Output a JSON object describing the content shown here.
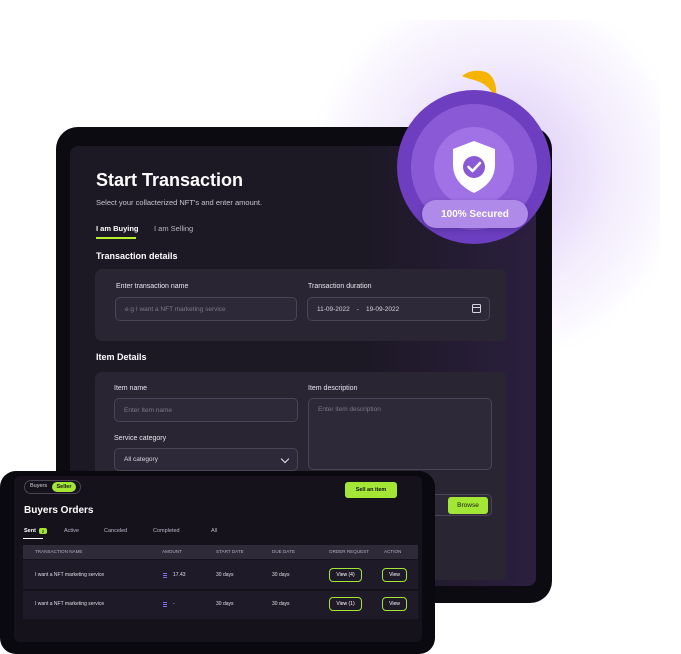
{
  "main": {
    "title": "Start Transaction",
    "subtitle": "Select your collacterized NFT's and enter amount.",
    "tabs": [
      {
        "label": "I am Buying",
        "active": true
      },
      {
        "label": "I am Selling",
        "active": false
      }
    ],
    "transaction_details": {
      "heading": "Transaction details",
      "name_label": "Enter transaction name",
      "name_placeholder": "e.g I want a NFT marketing service",
      "duration_label": "Transaction duration",
      "start_date": "11-09-2022",
      "separator": "-",
      "end_date": "19-09-2022"
    },
    "item_details": {
      "heading": "Item Details",
      "name_label": "Item name",
      "name_placeholder": "Enter Item name",
      "description_label": "Item description",
      "description_placeholder": "Enter item description",
      "category_label": "Service category",
      "category_value": "All category",
      "browse_label": "Browse"
    }
  },
  "badge": {
    "label": "100% Secured",
    "colors": {
      "outer": "#6d3fc0",
      "accent": "#f5b400"
    }
  },
  "orders": {
    "toggle": {
      "buyers": "Buyers",
      "seller": "Seller",
      "active": "Seller"
    },
    "sell_button": "Sell an item",
    "title": "Buyers Orders",
    "tabs": [
      {
        "label": "Sent",
        "count": "2",
        "active": true
      },
      {
        "label": "Active"
      },
      {
        "label": "Canceled"
      },
      {
        "label": "Completed"
      },
      {
        "label": "All"
      }
    ],
    "columns": [
      "TRANSACTION NAME",
      "AMOUNT",
      "START DATE",
      "DUE DATE",
      "ORDER REQUEST",
      "ACTION"
    ],
    "rows": [
      {
        "name": "I want a NFT marketing service",
        "amount": "17.43",
        "start": "30 days",
        "due": "30 days",
        "request": "View (4)",
        "action": "View"
      },
      {
        "name": "I want a NFT marketing service",
        "amount": "-",
        "start": "30 days",
        "due": "30 days",
        "request": "View (1)",
        "action": "View"
      }
    ]
  },
  "colors": {
    "accent_green": "#a3e635",
    "panel": "#2a2533",
    "background": "#1c1824"
  }
}
